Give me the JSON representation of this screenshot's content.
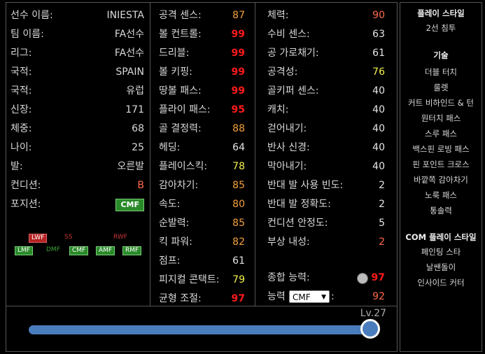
{
  "profile": [
    {
      "label": "선수 이름:",
      "value": "INIESTA"
    },
    {
      "label": "팀 이름:",
      "value": "FA선수"
    },
    {
      "label": "리그:",
      "value": "FA선수"
    },
    {
      "label": "국적:",
      "value": "SPAIN"
    },
    {
      "label": "국적:",
      "value": "유럽"
    },
    {
      "label": "신장:",
      "value": "171"
    },
    {
      "label": "체중:",
      "value": "68"
    },
    {
      "label": "나이:",
      "value": "25"
    },
    {
      "label": "발:",
      "value": "오른발"
    },
    {
      "label": "컨디션:",
      "value": "B"
    },
    {
      "label": "포지션:",
      "value": "CMF"
    }
  ],
  "positions": {
    "row1": [
      "LWF",
      "SS",
      "RWF"
    ],
    "row2": [
      "LMF",
      "DMF",
      "CMF",
      "AMF",
      "RMF"
    ]
  },
  "stats_col2": [
    {
      "label": "공격 센스:",
      "value": "87"
    },
    {
      "label": "볼 컨트롤:",
      "value": "99"
    },
    {
      "label": "드리블:",
      "value": "99"
    },
    {
      "label": "볼 키핑:",
      "value": "99"
    },
    {
      "label": "땅볼 패스:",
      "value": "99"
    },
    {
      "label": "플라이 패스:",
      "value": "95"
    },
    {
      "label": "골 결정력:",
      "value": "88"
    },
    {
      "label": "헤딩:",
      "value": "64"
    },
    {
      "label": "플레이스킥:",
      "value": "78"
    },
    {
      "label": "감아차기:",
      "value": "85"
    },
    {
      "label": "속도:",
      "value": "80"
    },
    {
      "label": "순발력:",
      "value": "85"
    },
    {
      "label": "킥 파워:",
      "value": "82"
    },
    {
      "label": "점프:",
      "value": "61"
    },
    {
      "label": "피지컬 콘택트:",
      "value": "79"
    },
    {
      "label": "균형 조절:",
      "value": "97"
    }
  ],
  "stats_col3": [
    {
      "label": "체력:",
      "value": "90"
    },
    {
      "label": "수비 센스:",
      "value": "63"
    },
    {
      "label": "공 가로채기:",
      "value": "61"
    },
    {
      "label": "공격성:",
      "value": "76"
    },
    {
      "label": "골키퍼 센스:",
      "value": "40"
    },
    {
      "label": "캐치:",
      "value": "40"
    },
    {
      "label": "걷어내기:",
      "value": "40"
    },
    {
      "label": "반사 신경:",
      "value": "40"
    },
    {
      "label": "막아내기:",
      "value": "40"
    },
    {
      "label": "반대 발 사용 빈도:",
      "value": "2"
    },
    {
      "label": "반대 발 정확도:",
      "value": "2"
    },
    {
      "label": "컨디션 안정도:",
      "value": "5"
    },
    {
      "label": "부상 내성:",
      "value": "2"
    }
  ],
  "overall": {
    "label": "종합 능력:",
    "value": "97"
  },
  "position_rating": {
    "label": "능력",
    "select": "CMF",
    "value": "92"
  },
  "right_panel": {
    "style_header": "플레이 스타일",
    "style_value": "2선 침투",
    "skills_header": "기술",
    "skills": [
      "더블 터치",
      "룰렛",
      "커트 비하인드 & 턴",
      "원터치 패스",
      "스루 패스",
      "백스핀 로빙 패스",
      "핀 포인트 크로스",
      "바깥쪽 감아차기",
      "노룩 패스",
      "통솔력"
    ],
    "com_header": "COM 플레이 스타일",
    "com_styles": [
      "페인팅 스타",
      "날쌘돌이",
      "인사이드 커터"
    ]
  },
  "level": {
    "label": "Lv.27",
    "fraction": 1.0
  },
  "colors": {
    "red": "#ff1a1a",
    "orange": "#f3a03a",
    "yellow": "#f4f14d",
    "slider": "#4a7dbd"
  }
}
